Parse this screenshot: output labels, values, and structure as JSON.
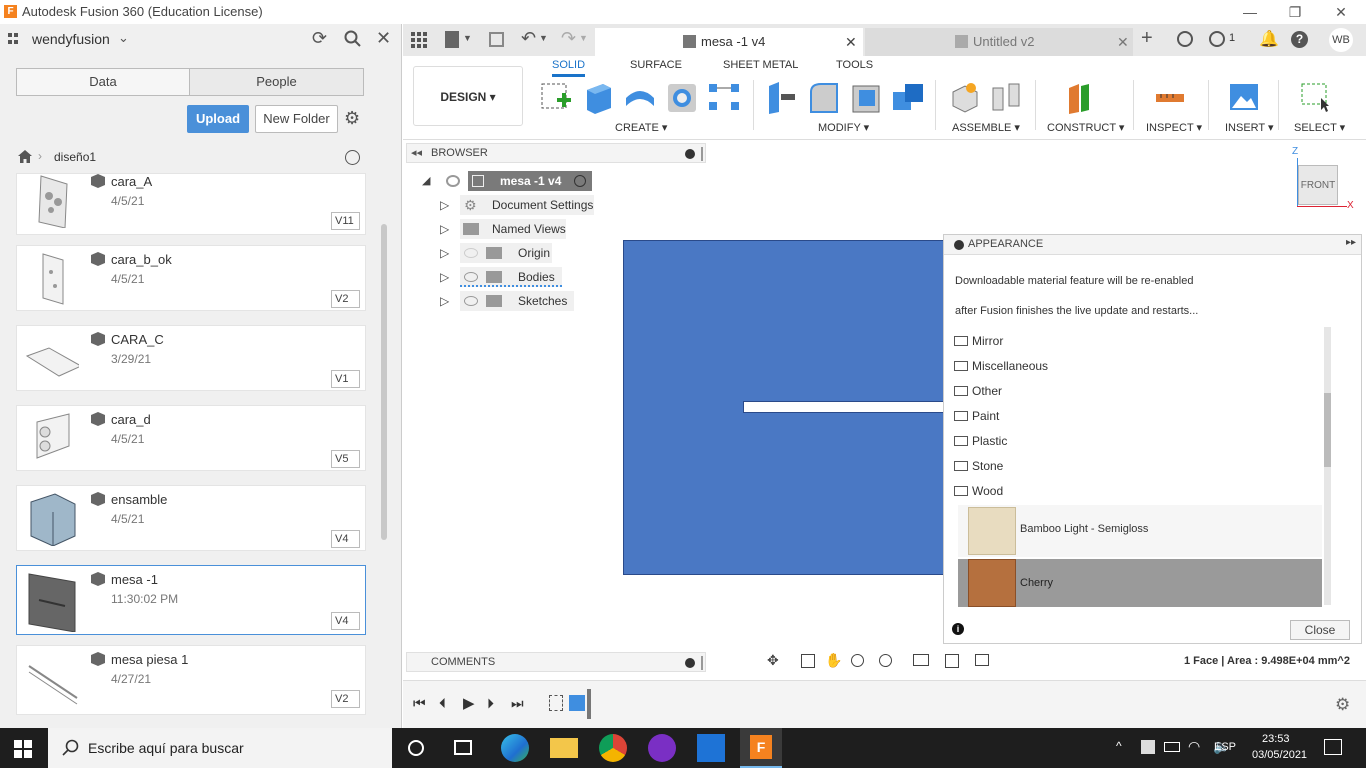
{
  "window": {
    "title": "Autodesk Fusion 360 (Education License)",
    "app_icon_letter": "F"
  },
  "left_panel": {
    "user": "wendyfusion",
    "tabs": [
      "Data",
      "People"
    ],
    "upload_label": "Upload",
    "new_folder_label": "New Folder",
    "breadcrumb": "diseño1",
    "files": [
      {
        "name": "cara_A",
        "date": "4/5/21",
        "version": "V11"
      },
      {
        "name": "cara_b_ok",
        "date": "4/5/21",
        "version": "V2"
      },
      {
        "name": "CARA_C",
        "date": "3/29/21",
        "version": "V1"
      },
      {
        "name": "cara_d",
        "date": "4/5/21",
        "version": "V5"
      },
      {
        "name": "ensamble",
        "date": "4/5/21",
        "version": "V4"
      },
      {
        "name": "mesa -1",
        "date": "11:30:02 PM",
        "version": "V4"
      },
      {
        "name": "mesa piesa 1",
        "date": "4/27/21",
        "version": "V2"
      }
    ]
  },
  "doc_tabs": [
    {
      "label": "mesa -1 v4",
      "active": true
    },
    {
      "label": "Untitled v2",
      "active": false
    }
  ],
  "top_right": {
    "jobs_count": "1",
    "user_initials": "WB"
  },
  "toolbar": {
    "workspace": "DESIGN",
    "tabs": [
      "SOLID",
      "SURFACE",
      "SHEET METAL",
      "TOOLS"
    ],
    "groups": [
      "CREATE",
      "MODIFY",
      "ASSEMBLE",
      "CONSTRUCT",
      "INSPECT",
      "INSERT",
      "SELECT"
    ]
  },
  "browser": {
    "title": "BROWSER",
    "root": "mesa -1 v4",
    "items": [
      "Document Settings",
      "Named Views",
      "Origin",
      "Bodies",
      "Sketches"
    ]
  },
  "viewcube": {
    "face": "FRONT",
    "axis_z": "Z",
    "axis_x": "X"
  },
  "appearance": {
    "title": "APPEARANCE",
    "message_line1": "Downloadable material feature will be re-enabled",
    "message_line2": "after Fusion finishes the live update and restarts...",
    "folders": [
      "Mirror",
      "Miscellaneous",
      "Other",
      "Paint",
      "Plastic",
      "Stone",
      "Wood"
    ],
    "materials": [
      "Bamboo Light - Semigloss",
      "Cherry"
    ],
    "close_label": "Close"
  },
  "comments_label": "COMMENTS",
  "status": "1 Face | Area : 9.498E+04 mm^2",
  "taskbar": {
    "search_placeholder": "Escribe aquí para buscar",
    "lang": "ESP",
    "time": "23:53",
    "date": "03/05/2021"
  },
  "colors": {
    "accent": "#4a90d9",
    "body_blue": "#4a78c4",
    "fusion_orange": "#f5821f"
  }
}
